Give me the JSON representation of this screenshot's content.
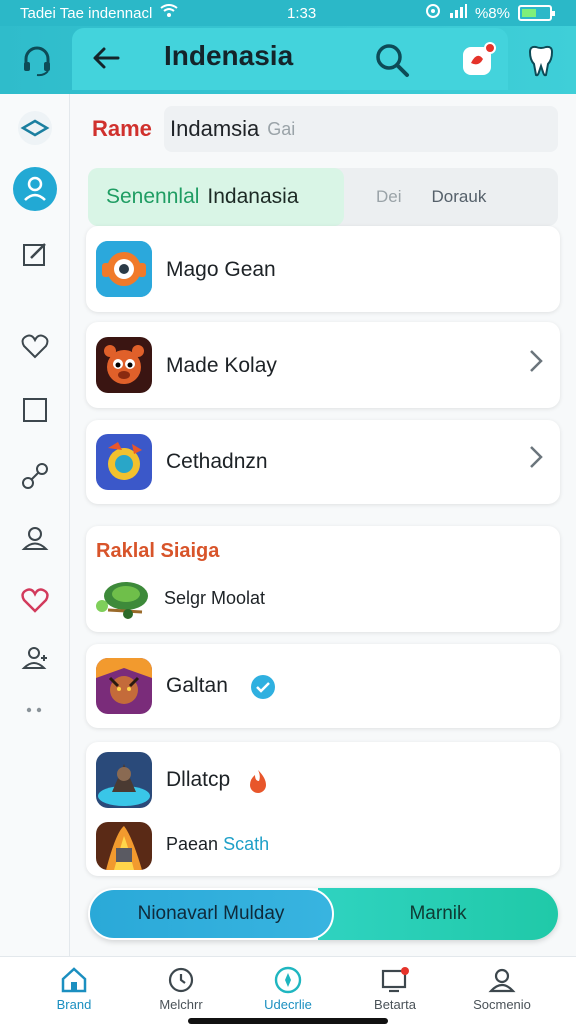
{
  "status_bar": {
    "left_text": "Tadei Tae indennacl",
    "time": "1:33",
    "battery_text": "%8%"
  },
  "header": {
    "title": "Indenasia",
    "icons": [
      "headset-icon",
      "back-arrow-icon",
      "search-icon",
      "notification-icon",
      "tooth-icon"
    ],
    "accent": "#2fbccb"
  },
  "side_rail": {
    "icons": [
      "layers-icon",
      "profile-icon",
      "edit-icon",
      "heart-icon",
      "square-icon",
      "link-icon",
      "person-icon",
      "heart-filled-icon",
      "add-user-icon",
      "more-icon"
    ]
  },
  "form": {
    "name_label": "Rame",
    "name_value": "Indamsia",
    "name_placeholder": "Gai"
  },
  "segmented": {
    "active_prefix": "Senennlal",
    "active_label": "Indanasia",
    "option_muted": "Dei",
    "option_label": "Dorauk"
  },
  "apps": [
    {
      "label": "Mago Gean",
      "icon": "robot-app-icon"
    },
    {
      "label": "Made Kolay",
      "icon": "bear-app-icon"
    },
    {
      "label": "Cethadnzn",
      "icon": "globe-app-icon"
    }
  ],
  "section": {
    "title": "Raklal Siaiga",
    "item_label": "Selgr Moolat"
  },
  "games": [
    {
      "label": "Galtan",
      "icon": "warrior-app-icon"
    },
    {
      "label": "Dllatcp",
      "icon": "knight-app-icon"
    }
  ],
  "last_item": {
    "label_a": "Paean",
    "label_b": "Scath"
  },
  "cta": {
    "left_label": "Nionavarl Mulday",
    "right_label": "Marnik"
  },
  "bottom_nav": [
    {
      "label": "Brand",
      "icon": "home-icon",
      "active": true
    },
    {
      "label": "Melchrr",
      "icon": "clock-icon",
      "active": false
    },
    {
      "label": "Udecrlie",
      "icon": "compass-icon",
      "active": false
    },
    {
      "label": "Betarta",
      "icon": "monitor-icon",
      "active": false
    },
    {
      "label": "Socmenio",
      "icon": "user-icon",
      "active": false
    }
  ]
}
